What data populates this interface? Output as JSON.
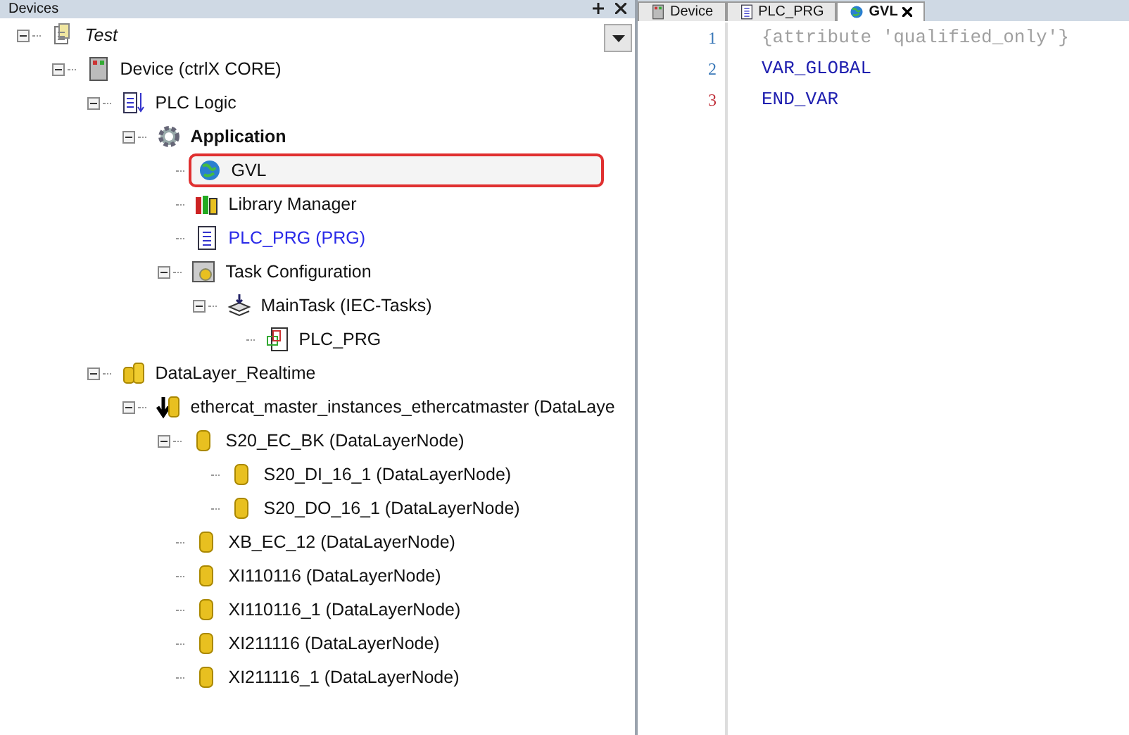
{
  "devices_panel": {
    "title": "Devices",
    "tree": [
      {
        "label": "Test",
        "kind": "project",
        "expanded": true,
        "selected": false,
        "children": [
          {
            "label": "Device (ctrlX CORE)",
            "kind": "device",
            "expanded": true,
            "selected": false,
            "children": [
              {
                "label": "PLC Logic",
                "kind": "plc-logic",
                "expanded": true,
                "selected": false,
                "children": [
                  {
                    "label": "Application",
                    "kind": "application",
                    "expanded": true,
                    "selected": false,
                    "children": [
                      {
                        "label": "GVL",
                        "kind": "gvl",
                        "selected": true
                      },
                      {
                        "label": "Library Manager",
                        "kind": "library",
                        "selected": false
                      },
                      {
                        "label": "PLC_PRG (PRG)",
                        "kind": "pou",
                        "selected": false
                      },
                      {
                        "label": "Task Configuration",
                        "kind": "task-config",
                        "expanded": true,
                        "selected": false,
                        "children": [
                          {
                            "label": "MainTask (IEC-Tasks)",
                            "kind": "task",
                            "expanded": true,
                            "selected": false,
                            "children": [
                              {
                                "label": "PLC_PRG",
                                "kind": "pou-call",
                                "selected": false
                              }
                            ]
                          }
                        ]
                      }
                    ]
                  }
                ]
              },
              {
                "label": "DataLayer_Realtime",
                "kind": "datalayer",
                "expanded": true,
                "selected": false,
                "children": [
                  {
                    "label": "ethercat_master_instances_ethercatmaster (DataLaye",
                    "kind": "master",
                    "expanded": true,
                    "selected": false,
                    "children": [
                      {
                        "label": "S20_EC_BK (DataLayerNode)",
                        "kind": "node",
                        "expanded": true,
                        "selected": false,
                        "children": [
                          {
                            "label": "S20_DI_16_1 (DataLayerNode)",
                            "kind": "node",
                            "selected": false
                          },
                          {
                            "label": "S20_DO_16_1 (DataLayerNode)",
                            "kind": "node",
                            "selected": false
                          }
                        ]
                      },
                      {
                        "label": "XB_EC_12 (DataLayerNode)",
                        "kind": "node",
                        "selected": false
                      },
                      {
                        "label": "XI110116 (DataLayerNode)",
                        "kind": "node",
                        "selected": false
                      },
                      {
                        "label": "XI110116_1 (DataLayerNode)",
                        "kind": "node",
                        "selected": false
                      },
                      {
                        "label": "XI211116 (DataLayerNode)",
                        "kind": "node",
                        "selected": false
                      },
                      {
                        "label": "XI211116_1 (DataLayerNode)",
                        "kind": "node",
                        "selected": false
                      }
                    ]
                  }
                ]
              }
            ]
          }
        ]
      }
    ]
  },
  "editor": {
    "tabs": [
      {
        "label": "Device",
        "kind": "device",
        "selected": false
      },
      {
        "label": "PLC_PRG",
        "kind": "pou",
        "selected": false
      },
      {
        "label": "GVL",
        "kind": "gvl",
        "selected": true
      }
    ],
    "lines": [
      {
        "number": "1",
        "code": "{attribute 'qualified_only'}",
        "kind": "pragma",
        "current": false
      },
      {
        "number": "2",
        "code": "VAR_GLOBAL",
        "kind": "keyword",
        "current": false
      },
      {
        "number": "3",
        "code": "END_VAR",
        "kind": "keyword",
        "current": true
      }
    ]
  }
}
